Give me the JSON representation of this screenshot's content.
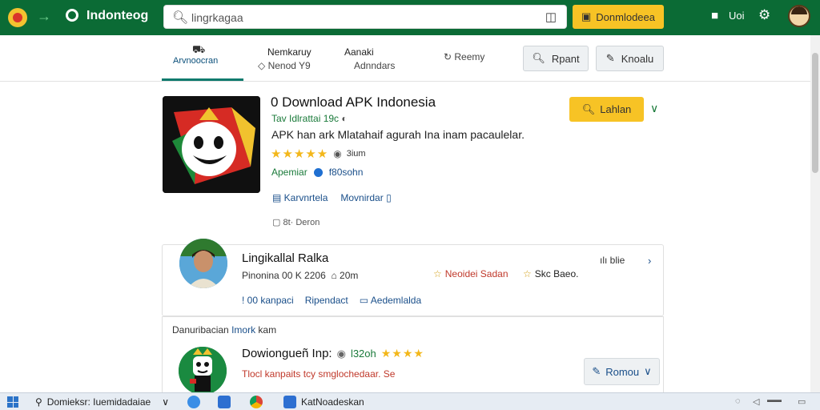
{
  "topbar": {
    "brand": "Indonteog",
    "search_placeholder": "lingrkagaa",
    "download_label": "Donmlodeea",
    "right_label": "Uoi"
  },
  "tabs": {
    "active": {
      "label": "Arvnoocran"
    },
    "tab2": {
      "line1": "Nemkaruy",
      "line2": "Nenod Y9"
    },
    "tab3": {
      "line1": "Aanaki",
      "line2": "Adnndars"
    },
    "tab4": {
      "label": "Reemy"
    },
    "print_label": "Rpant",
    "edit_label": "Knoalu"
  },
  "app": {
    "title": "0 Download APK Indonesia",
    "subtitle": "Tav Idlrattai 19c",
    "description": "APK han ark Mlatahaif agurah Ina inam pacaulelar.",
    "rating_text": "3ium",
    "category": "Apemiar",
    "category_link": "f80sohn",
    "link1": "Karvnrtela",
    "link2": "Movnirdar",
    "misc": "8t· Deron",
    "install_label": "Lahlan"
  },
  "developer": {
    "name": "Lingikallal Ralka",
    "meta1": "Pinonina 00 K 2206",
    "meta2": "20m",
    "badge1": "Neoidei Sadan",
    "badge2": "Skc Baeo.",
    "like_label": "blie",
    "link1": "! 00 kanpaci",
    "link2": "Ripendact",
    "link3": "Aedemlalda"
  },
  "list": {
    "header_text": "Danuribacian",
    "header_link": "Imork",
    "header_tail": "kam",
    "item_title": "Dowiongueñ Inp:",
    "item_rating": "l32oh",
    "item_desc": "Tlocl kanpaits tcy smglochedaar. Se",
    "follow_label": "Romou"
  },
  "taskbar": {
    "search_text": "Domieksr: Iuemidadaiae",
    "active_app": "KatNoadeskan"
  },
  "colors": {
    "topbar": "#0b6b35",
    "accent_yellow": "#f7c325",
    "link_blue": "#1a4f8a",
    "green_text": "#1a7a3a",
    "tab_indicator": "#0e7a6d"
  }
}
